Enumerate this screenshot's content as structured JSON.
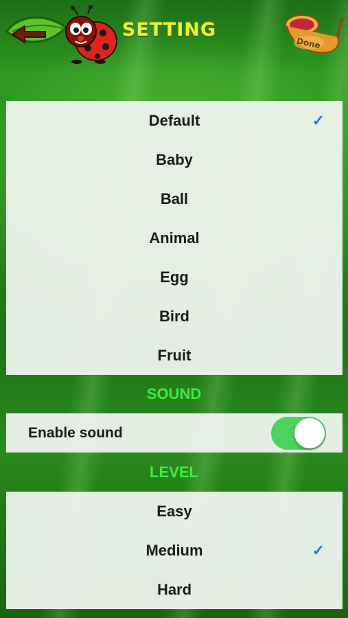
{
  "header": {
    "title": "SETTING",
    "done_label": "Done",
    "back_icon": "back-arrow-leaf-icon",
    "mascot_icon": "ladybug-icon",
    "done_icon": "horn-icon"
  },
  "theme": {
    "items": [
      {
        "label": "Default",
        "selected": true
      },
      {
        "label": "Baby",
        "selected": false
      },
      {
        "label": "Ball",
        "selected": false
      },
      {
        "label": "Animal",
        "selected": false
      },
      {
        "label": "Egg",
        "selected": false
      },
      {
        "label": "Bird",
        "selected": false
      },
      {
        "label": "Fruit",
        "selected": false
      }
    ],
    "check_glyph": "✓"
  },
  "sound": {
    "section_label": "SOUND",
    "enable_label": "Enable sound",
    "enabled": true
  },
  "level": {
    "section_label": "LEVEL",
    "items": [
      {
        "label": "Easy",
        "selected": false
      },
      {
        "label": "Medium",
        "selected": true
      },
      {
        "label": "Hard",
        "selected": false
      }
    ]
  },
  "colors": {
    "background": "#2a8c1f",
    "title": "#e7f23a",
    "section_label": "#37f040",
    "check": "#1a7be0",
    "toggle_on": "#4cd35f"
  }
}
